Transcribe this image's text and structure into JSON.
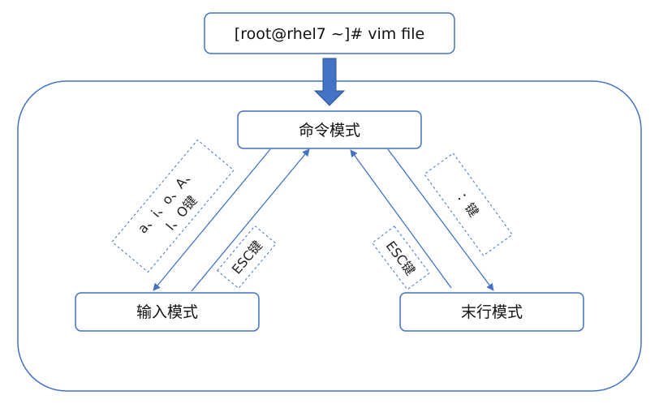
{
  "command": "[root@rhel7 ~]# vim file",
  "modes": {
    "command": "命令模式",
    "insert": "输入模式",
    "lastline": "末行模式"
  },
  "transitions": {
    "to_insert_line1": "a、i、o、A、",
    "to_insert_line2": "I、O键",
    "insert_to_command": "ESC键",
    "lastline_to_command": "ESC键",
    "to_lastline": "：键"
  },
  "colors": {
    "box_border": "#4472c4",
    "arrow": "#4472c4",
    "entry_arrow": "#4472c4",
    "label_border": "#4472c4"
  }
}
